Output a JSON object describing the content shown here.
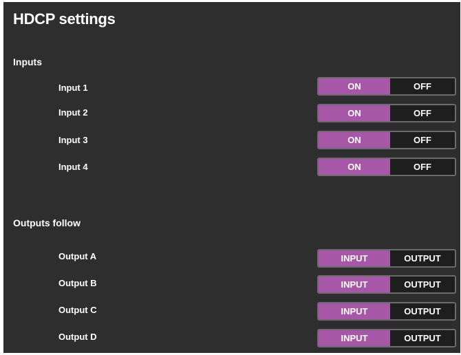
{
  "page_title": "HDCP settings",
  "inputs": {
    "heading": "Inputs",
    "rows": [
      {
        "label": "Input 1",
        "on_label": "ON",
        "off_label": "OFF",
        "selected": "ON"
      },
      {
        "label": "Input 2",
        "on_label": "ON",
        "off_label": "OFF",
        "selected": "ON"
      },
      {
        "label": "Input 3",
        "on_label": "ON",
        "off_label": "OFF",
        "selected": "ON"
      },
      {
        "label": "Input 4",
        "on_label": "ON",
        "off_label": "OFF",
        "selected": "ON"
      }
    ]
  },
  "outputs": {
    "heading": "Outputs follow",
    "rows": [
      {
        "label": "Output A",
        "input_label": "INPUT",
        "output_label": "OUTPUT",
        "selected": "INPUT"
      },
      {
        "label": "Output B",
        "input_label": "INPUT",
        "output_label": "OUTPUT",
        "selected": "INPUT"
      },
      {
        "label": "Output C",
        "input_label": "INPUT",
        "output_label": "OUTPUT",
        "selected": "INPUT"
      },
      {
        "label": "Output D",
        "input_label": "INPUT",
        "output_label": "OUTPUT",
        "selected": "INPUT"
      }
    ]
  },
  "colors": {
    "background": "#2e2e2e",
    "accent": "#a857a8",
    "toggle_inactive": "#1e1e1e",
    "toggle_border": "#6c6c6c",
    "text": "#ffffff"
  }
}
